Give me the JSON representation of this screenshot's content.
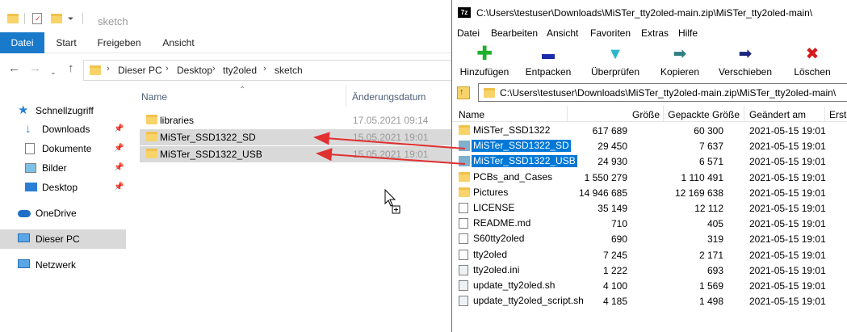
{
  "explorer": {
    "title": "sketch",
    "ribbon_tabs": [
      "Datei",
      "Start",
      "Freigeben",
      "Ansicht"
    ],
    "breadcrumb": [
      "Dieser PC",
      "Desktop",
      "tty2oled",
      "sketch"
    ],
    "nav": [
      {
        "label": "Schnellzugriff",
        "icon": "star-icon"
      },
      {
        "label": "Downloads",
        "icon": "download-icon"
      },
      {
        "label": "Dokumente",
        "icon": "document-icon"
      },
      {
        "label": "Bilder",
        "icon": "pictures-icon"
      },
      {
        "label": "Desktop",
        "icon": "desktop-icon"
      },
      {
        "label": "OneDrive",
        "icon": "cloud-icon"
      },
      {
        "label": "Dieser PC",
        "icon": "pc-icon"
      },
      {
        "label": "Netzwerk",
        "icon": "network-icon"
      }
    ],
    "columns": {
      "name": "Name",
      "date": "Änderungsdatum"
    },
    "files": [
      {
        "name": "libraries",
        "date": "17.05.2021 09:14"
      },
      {
        "name": "MiSTer_SSD1322_SD",
        "date": "15.05.2021 19:01"
      },
      {
        "name": "MiSTer_SSD1322_USB",
        "date": "15.05.2021 19:01"
      }
    ]
  },
  "zip": {
    "title": "C:\\Users\\testuser\\Downloads\\MiSTer_tty2oled-main.zip\\MiSTer_tty2oled-main\\",
    "app_icon": "7z",
    "menu": [
      "Datei",
      "Bearbeiten",
      "Ansicht",
      "Favoriten",
      "Extras",
      "Hilfe"
    ],
    "toolbar": [
      {
        "label": "Hinzufügen",
        "icon": "plus-icon",
        "color": "#1fb02a"
      },
      {
        "label": "Entpacken",
        "icon": "minus-icon",
        "color": "#1a2ca8"
      },
      {
        "label": "Überprüfen",
        "icon": "check-icon",
        "color": "#2ab7c9"
      },
      {
        "label": "Kopieren",
        "icon": "copy-arrow-icon",
        "color": "#2f7f84"
      },
      {
        "label": "Verschieben",
        "icon": "move-arrow-icon",
        "color": "#1a237e"
      },
      {
        "label": "Löschen",
        "icon": "delete-icon",
        "color": "#d81a1a"
      }
    ],
    "path": "C:\\Users\\testuser\\Downloads\\MiSTer_tty2oled-main.zip\\MiSTer_tty2oled-main\\",
    "columns": [
      "Name",
      "Größe",
      "Gepackte Größe",
      "Geändert am",
      "Erste"
    ],
    "rows": [
      {
        "name": "MiSTer_SSD1322",
        "size": "617 689",
        "packed": "60 300",
        "modified": "2021-05-15 19:01",
        "type": "folder"
      },
      {
        "name": "MiSTer_SSD1322_SD",
        "size": "29 450",
        "packed": "7 637",
        "modified": "2021-05-15 19:01",
        "type": "selected"
      },
      {
        "name": "MiSTer_SSD1322_USB",
        "size": "24 930",
        "packed": "6 571",
        "modified": "2021-05-15 19:01",
        "type": "selected"
      },
      {
        "name": "PCBs_and_Cases",
        "size": "1 550 279",
        "packed": "1 110 491",
        "modified": "2021-05-15 19:01",
        "type": "folder"
      },
      {
        "name": "Pictures",
        "size": "14 946 685",
        "packed": "12 169 638",
        "modified": "2021-05-15 19:01",
        "type": "folder"
      },
      {
        "name": "LICENSE",
        "size": "35 149",
        "packed": "12 112",
        "modified": "2021-05-15 19:01",
        "type": "file"
      },
      {
        "name": "README.md",
        "size": "710",
        "packed": "405",
        "modified": "2021-05-15 19:01",
        "type": "file"
      },
      {
        "name": "S60tty2oled",
        "size": "690",
        "packed": "319",
        "modified": "2021-05-15 19:01",
        "type": "file"
      },
      {
        "name": "tty2oled",
        "size": "7 245",
        "packed": "2 171",
        "modified": "2021-05-15 19:01",
        "type": "file"
      },
      {
        "name": "tty2oled.ini",
        "size": "1 222",
        "packed": "693",
        "modified": "2021-05-15 19:01",
        "type": "script"
      },
      {
        "name": "update_tty2oled.sh",
        "size": "4 100",
        "packed": "1 569",
        "modified": "2021-05-15 19:01",
        "type": "script"
      },
      {
        "name": "update_tty2oled_script.sh",
        "size": "4 185",
        "packed": "1 498",
        "modified": "2021-05-15 19:01",
        "type": "script"
      }
    ]
  },
  "colors": {
    "accent": "#0078d7",
    "ribbon_file": "#1979ca",
    "arrow": "#e03030"
  }
}
